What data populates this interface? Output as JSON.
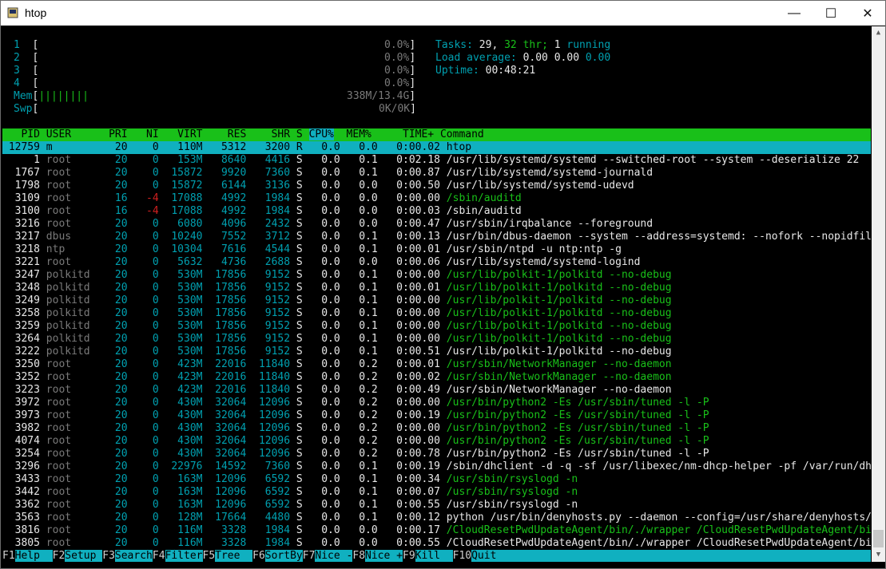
{
  "window": {
    "title": "htop",
    "minimize_glyph": "—",
    "maximize_glyph": "☐",
    "close_glyph": "✕"
  },
  "meters": {
    "cpus": [
      {
        "id": "1",
        "value": "0.0%"
      },
      {
        "id": "2",
        "value": "0.0%"
      },
      {
        "id": "3",
        "value": "0.0%"
      },
      {
        "id": "4",
        "value": "0.0%"
      }
    ],
    "mem": {
      "label": "Mem",
      "value": "338M/13.4G",
      "bar": "||||||||"
    },
    "swp": {
      "label": "Swp",
      "value": "0K/0K"
    },
    "tasks_label": "Tasks:",
    "tasks": "29,",
    "threads": "32",
    "thr_label": "thr;",
    "running": "1",
    "running_label": "running",
    "load_label": "Load average:",
    "load1": "0.00",
    "load5": "0.00",
    "load15": "0.00",
    "uptime_label": "Uptime:",
    "uptime": "00:48:21"
  },
  "columns": {
    "pid": "PID",
    "user": "USER",
    "pri": "PRI",
    "ni": "NI",
    "virt": "VIRT",
    "res": "RES",
    "shr": "SHR",
    "s": "S",
    "cpu": "CPU%",
    "mem": "MEM%",
    "time": "TIME+",
    "cmd": "Command"
  },
  "processes": [
    {
      "pid": "12759",
      "user": "m",
      "pri": "20",
      "ni": "0",
      "virt": "110M",
      "res": "5312",
      "shr": "3200",
      "s": "R",
      "cpu": "0.0",
      "mem": "0.0",
      "time": "0:00.02",
      "cmd": "htop",
      "thread": false
    },
    {
      "pid": "1",
      "user": "root",
      "pri": "20",
      "ni": "0",
      "virt": "153M",
      "res": "8640",
      "shr": "4416",
      "s": "S",
      "cpu": "0.0",
      "mem": "0.1",
      "time": "0:02.18",
      "cmd": "/usr/lib/systemd/systemd --switched-root --system --deserialize 22",
      "thread": false
    },
    {
      "pid": "1767",
      "user": "root",
      "pri": "20",
      "ni": "0",
      "virt": "15872",
      "res": "9920",
      "shr": "7360",
      "s": "S",
      "cpu": "0.0",
      "mem": "0.1",
      "time": "0:00.87",
      "cmd": "/usr/lib/systemd/systemd-journald",
      "thread": false
    },
    {
      "pid": "1798",
      "user": "root",
      "pri": "20",
      "ni": "0",
      "virt": "15872",
      "res": "6144",
      "shr": "3136",
      "s": "S",
      "cpu": "0.0",
      "mem": "0.0",
      "time": "0:00.50",
      "cmd": "/usr/lib/systemd/systemd-udevd",
      "thread": false
    },
    {
      "pid": "3109",
      "user": "root",
      "pri": "16",
      "ni": "-4",
      "virt": "17088",
      "res": "4992",
      "shr": "1984",
      "s": "S",
      "cpu": "0.0",
      "mem": "0.0",
      "time": "0:00.00",
      "cmd": "/sbin/auditd",
      "thread": true
    },
    {
      "pid": "3100",
      "user": "root",
      "pri": "16",
      "ni": "-4",
      "virt": "17088",
      "res": "4992",
      "shr": "1984",
      "s": "S",
      "cpu": "0.0",
      "mem": "0.0",
      "time": "0:00.03",
      "cmd": "/sbin/auditd",
      "thread": false
    },
    {
      "pid": "3216",
      "user": "root",
      "pri": "20",
      "ni": "0",
      "virt": "6080",
      "res": "4096",
      "shr": "2432",
      "s": "S",
      "cpu": "0.0",
      "mem": "0.0",
      "time": "0:00.47",
      "cmd": "/usr/sbin/irqbalance --foreground",
      "thread": false
    },
    {
      "pid": "3217",
      "user": "dbus",
      "pri": "20",
      "ni": "0",
      "virt": "10240",
      "res": "7552",
      "shr": "3712",
      "s": "S",
      "cpu": "0.0",
      "mem": "0.1",
      "time": "0:00.13",
      "cmd": "/usr/bin/dbus-daemon --system --address=systemd: --nofork --nopidfile --s",
      "thread": false
    },
    {
      "pid": "3218",
      "user": "ntp",
      "pri": "20",
      "ni": "0",
      "virt": "10304",
      "res": "7616",
      "shr": "4544",
      "s": "S",
      "cpu": "0.0",
      "mem": "0.1",
      "time": "0:00.01",
      "cmd": "/usr/sbin/ntpd -u ntp:ntp -g",
      "thread": false
    },
    {
      "pid": "3221",
      "user": "root",
      "pri": "20",
      "ni": "0",
      "virt": "5632",
      "res": "4736",
      "shr": "2688",
      "s": "S",
      "cpu": "0.0",
      "mem": "0.0",
      "time": "0:00.06",
      "cmd": "/usr/lib/systemd/systemd-logind",
      "thread": false
    },
    {
      "pid": "3247",
      "user": "polkitd",
      "pri": "20",
      "ni": "0",
      "virt": "530M",
      "res": "17856",
      "shr": "9152",
      "s": "S",
      "cpu": "0.0",
      "mem": "0.1",
      "time": "0:00.00",
      "cmd": "/usr/lib/polkit-1/polkitd --no-debug",
      "thread": true
    },
    {
      "pid": "3248",
      "user": "polkitd",
      "pri": "20",
      "ni": "0",
      "virt": "530M",
      "res": "17856",
      "shr": "9152",
      "s": "S",
      "cpu": "0.0",
      "mem": "0.1",
      "time": "0:00.01",
      "cmd": "/usr/lib/polkit-1/polkitd --no-debug",
      "thread": true
    },
    {
      "pid": "3249",
      "user": "polkitd",
      "pri": "20",
      "ni": "0",
      "virt": "530M",
      "res": "17856",
      "shr": "9152",
      "s": "S",
      "cpu": "0.0",
      "mem": "0.1",
      "time": "0:00.00",
      "cmd": "/usr/lib/polkit-1/polkitd --no-debug",
      "thread": true
    },
    {
      "pid": "3258",
      "user": "polkitd",
      "pri": "20",
      "ni": "0",
      "virt": "530M",
      "res": "17856",
      "shr": "9152",
      "s": "S",
      "cpu": "0.0",
      "mem": "0.1",
      "time": "0:00.00",
      "cmd": "/usr/lib/polkit-1/polkitd --no-debug",
      "thread": true
    },
    {
      "pid": "3259",
      "user": "polkitd",
      "pri": "20",
      "ni": "0",
      "virt": "530M",
      "res": "17856",
      "shr": "9152",
      "s": "S",
      "cpu": "0.0",
      "mem": "0.1",
      "time": "0:00.00",
      "cmd": "/usr/lib/polkit-1/polkitd --no-debug",
      "thread": true
    },
    {
      "pid": "3264",
      "user": "polkitd",
      "pri": "20",
      "ni": "0",
      "virt": "530M",
      "res": "17856",
      "shr": "9152",
      "s": "S",
      "cpu": "0.0",
      "mem": "0.1",
      "time": "0:00.00",
      "cmd": "/usr/lib/polkit-1/polkitd --no-debug",
      "thread": true
    },
    {
      "pid": "3222",
      "user": "polkitd",
      "pri": "20",
      "ni": "0",
      "virt": "530M",
      "res": "17856",
      "shr": "9152",
      "s": "S",
      "cpu": "0.0",
      "mem": "0.1",
      "time": "0:00.51",
      "cmd": "/usr/lib/polkit-1/polkitd --no-debug",
      "thread": false
    },
    {
      "pid": "3250",
      "user": "root",
      "pri": "20",
      "ni": "0",
      "virt": "423M",
      "res": "22016",
      "shr": "11840",
      "s": "S",
      "cpu": "0.0",
      "mem": "0.2",
      "time": "0:00.01",
      "cmd": "/usr/sbin/NetworkManager --no-daemon",
      "thread": true
    },
    {
      "pid": "3252",
      "user": "root",
      "pri": "20",
      "ni": "0",
      "virt": "423M",
      "res": "22016",
      "shr": "11840",
      "s": "S",
      "cpu": "0.0",
      "mem": "0.2",
      "time": "0:00.02",
      "cmd": "/usr/sbin/NetworkManager --no-daemon",
      "thread": true
    },
    {
      "pid": "3223",
      "user": "root",
      "pri": "20",
      "ni": "0",
      "virt": "423M",
      "res": "22016",
      "shr": "11840",
      "s": "S",
      "cpu": "0.0",
      "mem": "0.2",
      "time": "0:00.49",
      "cmd": "/usr/sbin/NetworkManager --no-daemon",
      "thread": false
    },
    {
      "pid": "3972",
      "user": "root",
      "pri": "20",
      "ni": "0",
      "virt": "430M",
      "res": "32064",
      "shr": "12096",
      "s": "S",
      "cpu": "0.0",
      "mem": "0.2",
      "time": "0:00.00",
      "cmd": "/usr/bin/python2 -Es /usr/sbin/tuned -l -P",
      "thread": true
    },
    {
      "pid": "3973",
      "user": "root",
      "pri": "20",
      "ni": "0",
      "virt": "430M",
      "res": "32064",
      "shr": "12096",
      "s": "S",
      "cpu": "0.0",
      "mem": "0.2",
      "time": "0:00.19",
      "cmd": "/usr/bin/python2 -Es /usr/sbin/tuned -l -P",
      "thread": true
    },
    {
      "pid": "3982",
      "user": "root",
      "pri": "20",
      "ni": "0",
      "virt": "430M",
      "res": "32064",
      "shr": "12096",
      "s": "S",
      "cpu": "0.0",
      "mem": "0.2",
      "time": "0:00.00",
      "cmd": "/usr/bin/python2 -Es /usr/sbin/tuned -l -P",
      "thread": true
    },
    {
      "pid": "4074",
      "user": "root",
      "pri": "20",
      "ni": "0",
      "virt": "430M",
      "res": "32064",
      "shr": "12096",
      "s": "S",
      "cpu": "0.0",
      "mem": "0.2",
      "time": "0:00.00",
      "cmd": "/usr/bin/python2 -Es /usr/sbin/tuned -l -P",
      "thread": true
    },
    {
      "pid": "3254",
      "user": "root",
      "pri": "20",
      "ni": "0",
      "virt": "430M",
      "res": "32064",
      "shr": "12096",
      "s": "S",
      "cpu": "0.0",
      "mem": "0.2",
      "time": "0:00.78",
      "cmd": "/usr/bin/python2 -Es /usr/sbin/tuned -l -P",
      "thread": false
    },
    {
      "pid": "3296",
      "user": "root",
      "pri": "20",
      "ni": "0",
      "virt": "22976",
      "res": "14592",
      "shr": "7360",
      "s": "S",
      "cpu": "0.0",
      "mem": "0.1",
      "time": "0:00.19",
      "cmd": "/sbin/dhclient -d -q -sf /usr/libexec/nm-dhcp-helper -pf /var/run/dhclien",
      "thread": false
    },
    {
      "pid": "3433",
      "user": "root",
      "pri": "20",
      "ni": "0",
      "virt": "163M",
      "res": "12096",
      "shr": "6592",
      "s": "S",
      "cpu": "0.0",
      "mem": "0.1",
      "time": "0:00.34",
      "cmd": "/usr/sbin/rsyslogd -n",
      "thread": true
    },
    {
      "pid": "3442",
      "user": "root",
      "pri": "20",
      "ni": "0",
      "virt": "163M",
      "res": "12096",
      "shr": "6592",
      "s": "S",
      "cpu": "0.0",
      "mem": "0.1",
      "time": "0:00.07",
      "cmd": "/usr/sbin/rsyslogd -n",
      "thread": true
    },
    {
      "pid": "3362",
      "user": "root",
      "pri": "20",
      "ni": "0",
      "virt": "163M",
      "res": "12096",
      "shr": "6592",
      "s": "S",
      "cpu": "0.0",
      "mem": "0.1",
      "time": "0:00.55",
      "cmd": "/usr/sbin/rsyslogd -n",
      "thread": false
    },
    {
      "pid": "3563",
      "user": "root",
      "pri": "20",
      "ni": "0",
      "virt": "128M",
      "res": "17664",
      "shr": "4480",
      "s": "S",
      "cpu": "0.0",
      "mem": "0.1",
      "time": "0:00.12",
      "cmd": "python /usr/bin/denyhosts.py --daemon --config=/usr/share/denyhosts/denyh",
      "thread": false
    },
    {
      "pid": "3816",
      "user": "root",
      "pri": "20",
      "ni": "0",
      "virt": "116M",
      "res": "3328",
      "shr": "1984",
      "s": "S",
      "cpu": "0.0",
      "mem": "0.0",
      "time": "0:00.17",
      "cmd": "/CloudResetPwdUpdateAgent/bin/./wrapper /CloudResetPwdUpdateAgent/bin/../",
      "thread": true
    },
    {
      "pid": "3805",
      "user": "root",
      "pri": "20",
      "ni": "0",
      "virt": "116M",
      "res": "3328",
      "shr": "1984",
      "s": "S",
      "cpu": "0.0",
      "mem": "0.0",
      "time": "0:00.55",
      "cmd": "/CloudResetPwdUpdateAgent/bin/./wrapper /CloudResetPwdUpdateAgent/bin/../",
      "thread": false
    }
  ],
  "function_keys": [
    {
      "key": "F1",
      "label": "Help  "
    },
    {
      "key": "F2",
      "label": "Setup "
    },
    {
      "key": "F3",
      "label": "Search"
    },
    {
      "key": "F4",
      "label": "Filter"
    },
    {
      "key": "F5",
      "label": "Tree  "
    },
    {
      "key": "F6",
      "label": "SortBy"
    },
    {
      "key": "F7",
      "label": "Nice -"
    },
    {
      "key": "F8",
      "label": "Nice +"
    },
    {
      "key": "F9",
      "label": "Kill  "
    },
    {
      "key": "F10",
      "label": "Quit"
    }
  ],
  "colors": {
    "green": "#19c019",
    "cyan": "#10b0c0",
    "teal_text": "#00a0b0",
    "red": "#d02020",
    "gray": "#7a7a7a"
  }
}
